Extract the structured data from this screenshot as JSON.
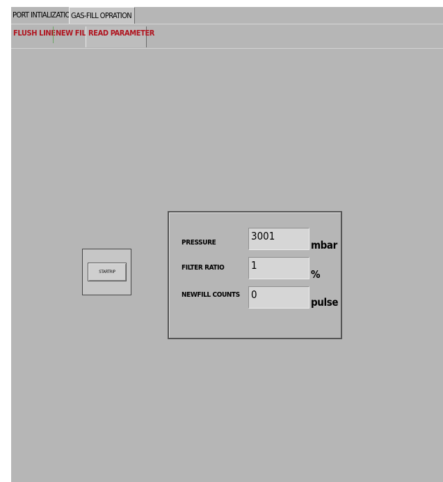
{
  "main_tabs": [
    {
      "label": "PORT INTIALIZATION"
    },
    {
      "label": "GAS-FILL OPRATION"
    }
  ],
  "sub_tabs": [
    {
      "label": "FLUSH LINE"
    },
    {
      "label": "NEW FILL"
    },
    {
      "label": "READ PARAMETER"
    }
  ],
  "start_button": {
    "label": "STARTRIP"
  },
  "parameters": [
    {
      "label": "PRESSURE",
      "value": "3001",
      "unit": "mbar"
    },
    {
      "label": "FILTER RATIO",
      "value": "1",
      "unit": "%"
    },
    {
      "label": "NEWFILL COUNTS",
      "value": "0",
      "unit": "pulse"
    }
  ],
  "colors": {
    "background": "#b6b6b6",
    "subtab_text": "#b0131e"
  }
}
